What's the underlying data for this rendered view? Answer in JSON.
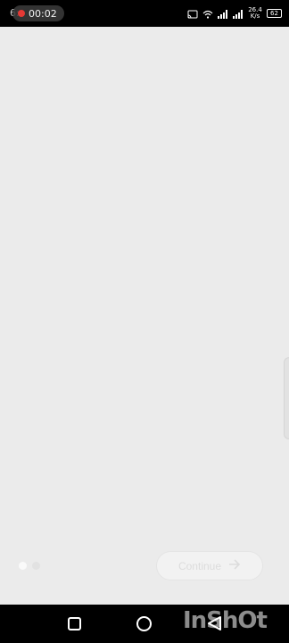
{
  "status_bar": {
    "time": "6:",
    "recording_time": "00:02",
    "net_speed_value": "26.4",
    "net_speed_unit": "K/s",
    "battery": "62"
  },
  "onboarding": {
    "continue_label": "Continue",
    "page_count": 2,
    "current_page": 1
  },
  "watermark": {
    "text": "InShOt"
  },
  "colors": {
    "background": "#ebebeb",
    "status_bar": "#000000",
    "recording": "#e53935"
  },
  "icons": {
    "cast": "cast-icon",
    "wifi": "wifi-icon",
    "signal": "signal-icon",
    "battery": "battery-icon",
    "arrow": "arrow-right-icon",
    "recent": "recent-apps-icon",
    "home": "home-icon",
    "back": "back-icon"
  }
}
